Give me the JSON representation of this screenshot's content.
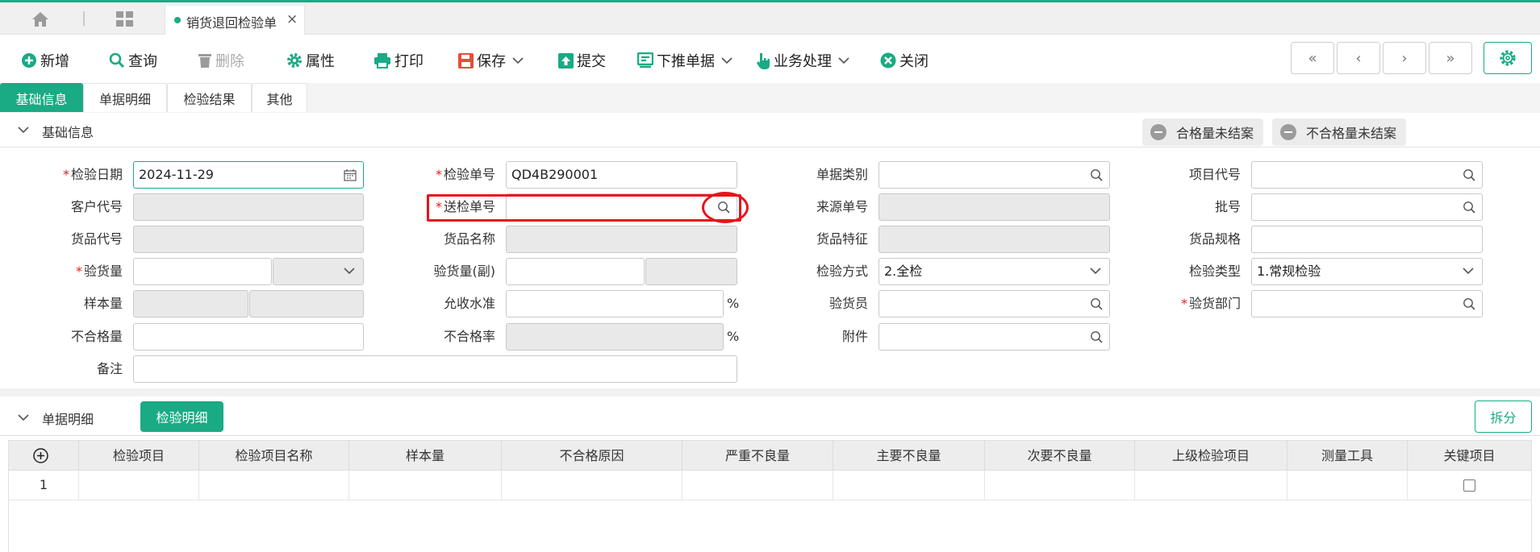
{
  "tabbar": {
    "doc_tab_label": "销货退回检验单",
    "close_glyph": "×"
  },
  "toolbar": {
    "new": "新增",
    "query": "查询",
    "delete": "删除",
    "properties": "属性",
    "print": "打印",
    "save": "保存",
    "submit": "提交",
    "push_down": "下推单据",
    "business": "业务处理",
    "close": "关闭"
  },
  "nav": {
    "first": "«",
    "prev": "‹",
    "next": "›",
    "last": "»"
  },
  "page_tabs": [
    "基础信息",
    "单据明细",
    "检验结果",
    "其他"
  ],
  "basic_section": {
    "title": "基础信息",
    "qualified_unsettled": "合格量未结案",
    "unqualified_unsettled": "不合格量未结案"
  },
  "form": {
    "inspect_date": {
      "label": "检验日期",
      "value": "2024-11-29"
    },
    "inspect_no": {
      "label": "检验单号",
      "value": "QD4B290001"
    },
    "doc_type": {
      "label": "单据类别",
      "value": ""
    },
    "project_code": {
      "label": "项目代号",
      "value": ""
    },
    "customer_code": {
      "label": "客户代号",
      "value": ""
    },
    "submit_no": {
      "label": "送检单号",
      "value": ""
    },
    "source_no": {
      "label": "来源单号",
      "value": ""
    },
    "batch_no": {
      "label": "批号",
      "value": ""
    },
    "goods_code": {
      "label": "货品代号",
      "value": ""
    },
    "goods_name": {
      "label": "货品名称",
      "value": ""
    },
    "goods_feature": {
      "label": "货品特征",
      "value": ""
    },
    "goods_spec": {
      "label": "货品规格",
      "value": ""
    },
    "inspect_qty": {
      "label": "验货量",
      "value": ""
    },
    "inspect_qty_sub": {
      "label": "验货量(副)",
      "value": ""
    },
    "inspect_method": {
      "label": "检验方式",
      "value": "2.全检"
    },
    "inspect_type": {
      "label": "检验类型",
      "value": "1.常规检验"
    },
    "sample_qty": {
      "label": "样本量",
      "value": ""
    },
    "accept_level": {
      "label": "允收水准",
      "value": ""
    },
    "inspector": {
      "label": "验货员",
      "value": ""
    },
    "inspect_dept": {
      "label": "验货部门",
      "value": ""
    },
    "unqualified_qty": {
      "label": "不合格量",
      "value": ""
    },
    "unqualified_rate": {
      "label": "不合格率",
      "value": ""
    },
    "attachment": {
      "label": "附件",
      "value": ""
    },
    "remark": {
      "label": "备注",
      "value": ""
    },
    "percent_sign": "%",
    "required_mark": "*"
  },
  "detail_section": {
    "title": "单据明细",
    "inspect_detail_btn": "检验明细",
    "split_btn": "拆分"
  },
  "grid": {
    "columns": [
      "检验项目",
      "检验项目名称",
      "样本量",
      "不合格原因",
      "严重不良量",
      "主要不良量",
      "次要不良量",
      "上级检验项目",
      "测量工具",
      "关键项目"
    ],
    "rows": [
      {
        "row_no": "1",
        "key_item_checked": false
      }
    ]
  },
  "colors": {
    "accent": "#1aaa84",
    "highlight": "#e8141b",
    "required": "#e02020"
  },
  "icons": [
    "home-icon",
    "grid-icon",
    "plus-circle-icon",
    "search-icon",
    "trash-icon",
    "gear-icon",
    "printer-icon",
    "save-icon",
    "upload-icon",
    "push-down-icon",
    "hand-pointer-icon",
    "close-circle-icon",
    "calendar-icon",
    "chevron-down-icon",
    "minus-circle-icon"
  ]
}
